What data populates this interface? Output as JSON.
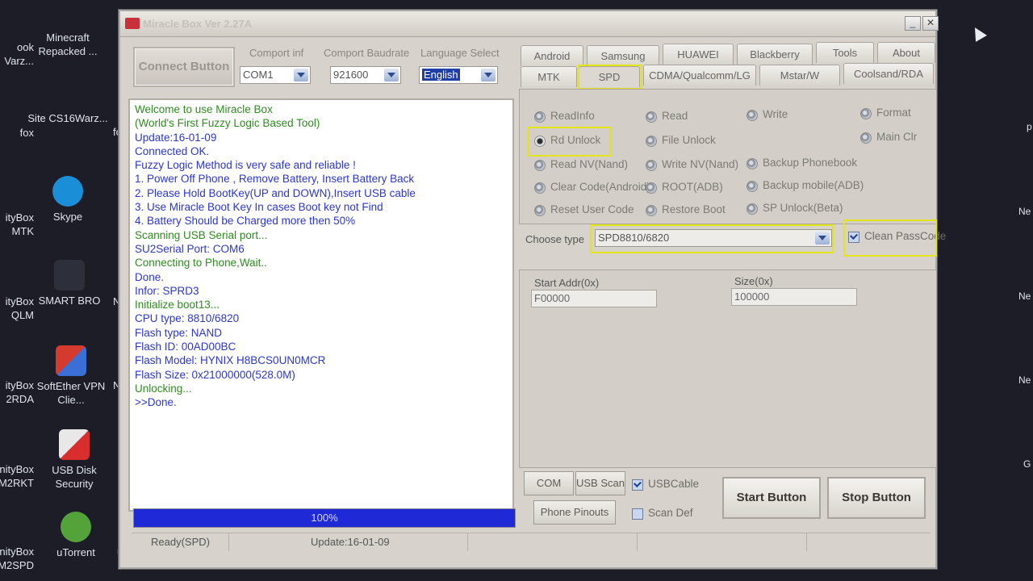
{
  "desktop": {
    "icons": [
      {
        "label": "Minecraft Repacked ...",
        "color": "#5e7d3a"
      },
      {
        "label": "Site CS16Warz...",
        "color": "#3a3f52"
      },
      {
        "label": "Skype",
        "color": "#1a8fd8"
      },
      {
        "label": "SMART BRO",
        "color": "#2d2f3a"
      },
      {
        "label": "SoftEther VPN Clie...",
        "color": "#c83a2e"
      },
      {
        "label": "USB Disk Security",
        "color": "#d92e2e"
      },
      {
        "label": "uTorrent",
        "color": "#53a33a"
      }
    ],
    "left_labels": [
      "ook",
      "Varz...",
      "fox",
      "ityBox",
      "MTK",
      "ityBox",
      "QLM",
      "ityBox",
      "2RDA",
      "nityBox",
      "M2RKT",
      "nityBox",
      "M2SPD"
    ],
    "right_labels": [
      "p",
      "Ne",
      "Ne",
      "Ne",
      "G"
    ],
    "mid_labels": [
      "fo",
      "Ne",
      "Ne",
      "un"
    ]
  },
  "window": {
    "title": "Miracle Box Ver 2.27A",
    "minimize": "_",
    "close": "✕"
  },
  "controls": {
    "connect_button": "Connect Button",
    "comport_label": "Comport inf",
    "comport_value": "COM1",
    "baud_label": "Comport Baudrate",
    "baud_value": "921600",
    "language_label": "Language Select",
    "language_value": "English"
  },
  "log": [
    {
      "text": "Welcome to use Miracle Box",
      "color": "green"
    },
    {
      "text": "(World's First Fuzzy Logic Based Tool)",
      "color": "green"
    },
    {
      "text": "Update:16-01-09",
      "color": "blue"
    },
    {
      "text": "Connected OK.",
      "color": "blue"
    },
    {
      "text": "Fuzzy Logic Method is very safe and reliable !",
      "color": "blue"
    },
    {
      "text": "1. Power Off Phone , Remove Battery, Insert Battery Back",
      "color": "blue"
    },
    {
      "text": "2. Please Hold BootKey(UP and DOWN),Insert USB cable",
      "color": "blue"
    },
    {
      "text": "3. Use Miracle Boot Key In cases Boot key not Find",
      "color": "blue"
    },
    {
      "text": "4. Battery Should be Charged more then 50%",
      "color": "blue"
    },
    {
      "text": "Scanning USB Serial port...",
      "color": "green"
    },
    {
      "text": "SU2Serial Port: COM6",
      "color": "blue"
    },
    {
      "text": "Connecting to Phone,Wait..",
      "color": "green"
    },
    {
      "text": "Done.",
      "color": "blue"
    },
    {
      "text": "Infor: SPRD3",
      "color": "blue"
    },
    {
      "text": "Initialize boot13...",
      "color": "green"
    },
    {
      "text": "CPU   type: 8810/6820",
      "color": "blue"
    },
    {
      "text": "Flash  type: NAND",
      "color": "blue"
    },
    {
      "text": "Flash    ID: 00AD00BC",
      "color": "blue"
    },
    {
      "text": "Flash Model: HYNIX H8BCS0UN0MCR",
      "color": "blue"
    },
    {
      "text": "Flash  Size: 0x21000000(528.0M)",
      "color": "blue"
    },
    {
      "text": "Unlocking...",
      "color": "green"
    },
    {
      "text": ">>Done.",
      "color": "blue"
    }
  ],
  "progress": {
    "label": "100%",
    "value": 1.0
  },
  "status": {
    "state": "Ready(SPD)",
    "update": "Update:16-01-09"
  },
  "tabs_row1": [
    "Android",
    "Samsung",
    "HUAWEI",
    "Blackberry",
    "Tools",
    "About"
  ],
  "tabs_row2": [
    "MTK",
    "SPD",
    "CDMA/Qualcomm/LG",
    "Mstar/W",
    "Coolsand/RDA"
  ],
  "active_tab": "SPD",
  "options": {
    "col1": [
      "ReadInfo",
      "Rd Unlock",
      "Read NV(Nand)",
      "Clear Code(Android)",
      "Reset User Code"
    ],
    "col2": [
      "Read",
      "File Unlock",
      "Write NV(Nand)",
      "ROOT(ADB)",
      "Restore Boot"
    ],
    "col3": [
      "Write",
      "Backup Phonebook",
      "Backup mobile(ADB)",
      "SP Unlock(Beta)"
    ],
    "col4": [
      "Format",
      "Main Clr"
    ],
    "selected": "Rd Unlock"
  },
  "choose_type": {
    "label": "Choose  type",
    "value": "SPD8810/6820"
  },
  "clean_passcode": {
    "label": "Clean PassCode",
    "checked": true
  },
  "addresses": {
    "start_label": "Start Addr(0x)",
    "start_value": "F00000",
    "size_label": "Size(0x)",
    "size_value": "100000"
  },
  "bottom": {
    "com_scan": "COM Scan",
    "usb_scan": "USB Scan",
    "usb_cable": "USBCable",
    "phone_pinouts": "Phone Pinouts",
    "scan_def": "Scan Def",
    "start_button": "Start Button",
    "stop_button": "Stop Button"
  },
  "highlight_color": "#e4e41a"
}
